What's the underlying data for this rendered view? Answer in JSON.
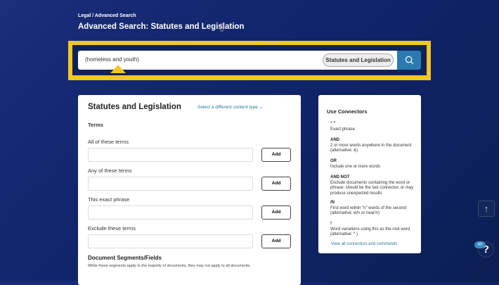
{
  "breadcrumb": "Legal / Advanced Search",
  "title": "Advanced Search: Statutes and Legislation",
  "search": {
    "value": "(homeless and youth)",
    "content_type": "Statutes and Legislation"
  },
  "form": {
    "heading": "Statutes and Legislation",
    "select_link": "Select a different content type",
    "terms_heading": "Terms",
    "fields": [
      {
        "label": "All of these terms",
        "value": "",
        "button": "Add"
      },
      {
        "label": "Any of these terms",
        "value": "",
        "button": "Add"
      },
      {
        "label": "This exact phrase",
        "value": "",
        "button": "Add"
      },
      {
        "label": "Exclude these terms",
        "value": "",
        "button": "Add"
      }
    ],
    "segments_heading": "Document Segments/Fields",
    "segments_note": "While these segments apply to the majority of documents, they may not apply to all documents."
  },
  "connectors": {
    "heading": "Use Connectors",
    "items": [
      {
        "op": "\" \"",
        "desc": "Exact phrase"
      },
      {
        "op": "AND",
        "desc": "2 or more words anywhere in the document (alternative: &)"
      },
      {
        "op": "OR",
        "desc": "Include one or more words"
      },
      {
        "op": "AND NOT",
        "desc": "Exclude documents containing the word or phrase; should be the last connector, or may produce unexpected results"
      },
      {
        "op": "/N",
        "desc": "First word within \"n\" words of the second (alternative: w/n or near/n)"
      },
      {
        "op": "!",
        "desc": "Word variations using this as the root word (alternative: * )"
      }
    ],
    "link": "View all connectors and commands"
  },
  "help": {
    "badge": "40",
    "label": "?"
  },
  "colors": {
    "highlight": "#f5c624",
    "accent": "#2a7ab0",
    "background": "#10246a"
  }
}
